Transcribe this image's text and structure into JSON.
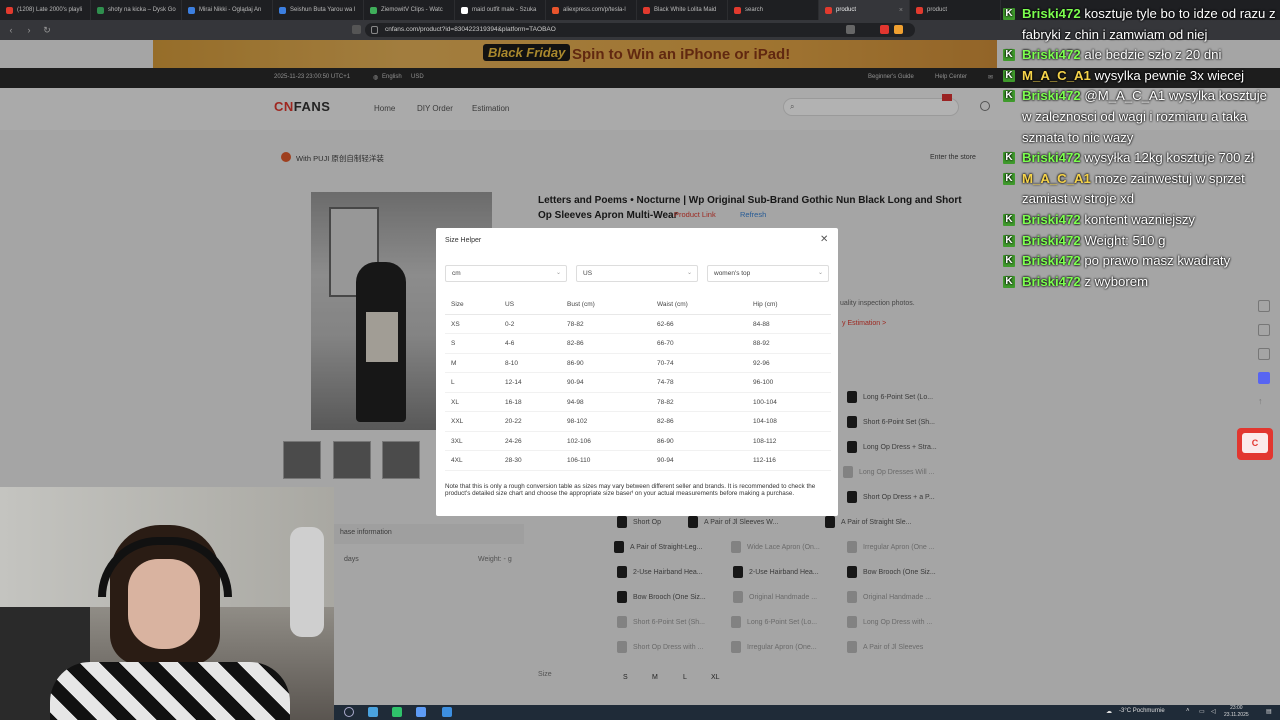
{
  "browser": {
    "tabs": [
      {
        "label": "(1208) Late 2000's playli",
        "color": "#e23a2e"
      },
      {
        "label": "shoty na kicka – Dysk Go",
        "color": "#2f8f4e"
      },
      {
        "label": "Mirai Nikki - Oglądaj An",
        "color": "#3c7fe0"
      },
      {
        "label": "Seishun Buta Yarou wa I",
        "color": "#3c7fe0"
      },
      {
        "label": "ZiemowitV Clips - Watc",
        "color": "#3fae5a"
      },
      {
        "label": "maid outfit male - Szuka",
        "color": "#ffffff"
      },
      {
        "label": "aliexpress.com/p/tesla-l",
        "color": "#e8542c"
      },
      {
        "label": "Black White Lolita Maid",
        "color": "#e23a2e"
      },
      {
        "label": "search",
        "color": "#e23a2e"
      },
      {
        "label": "product",
        "color": "#e23a2e",
        "active": true
      },
      {
        "label": "product",
        "color": "#e23a2e"
      }
    ],
    "url": "cnfans.com/product?id=830422319394&platform=TAOBAO"
  },
  "banner": {
    "badge": "Black Friday",
    "text": "Spin to Win an iPhone or iPad!"
  },
  "topbar": {
    "datetime": "2025-11-23 23:00:50 UTC+1",
    "lang": "English",
    "currency": "USD",
    "guide": "Beginner's Guide",
    "help": "Help Center"
  },
  "header": {
    "logo_a": "CN",
    "logo_b": "FANS",
    "nav": [
      "Home",
      "DIY Order",
      "Estimation"
    ]
  },
  "store": {
    "name": "With PUJI 原创自制轻洋装",
    "enter": "Enter the store"
  },
  "product": {
    "title": "Letters and Poems • Nocturne | Wp Original Sub-Brand Gothic Nun Black Long and Short Op Sleeves Apron Multi-Wear",
    "link": "Product Link",
    "refresh": "Refresh",
    "qc": "uality inspection photos.",
    "estimation": "y Estimation >"
  },
  "options": [
    {
      "label": "Long 6-Point Set (Lo...",
      "light": false
    },
    {
      "label": "Short 6-Point Set (Sh...",
      "light": false
    },
    {
      "label": "Long Op Dress + Stra...",
      "light": false
    },
    {
      "label": "Long Op Dresses Will ...",
      "light": true
    },
    {
      "label": "Short Op Dress + a P...",
      "light": false
    },
    {
      "label": "Short Op",
      "light": false
    },
    {
      "label": "A Pair of Jl Sleeves W...",
      "light": false
    },
    {
      "label": "A Pair of Straight Sle...",
      "light": false
    },
    {
      "label": "A Pair of Straight-Leg...",
      "light": false
    },
    {
      "label": "Wide Lace Apron (On...",
      "light": true
    },
    {
      "label": "Irregular Apron (One ...",
      "light": true
    },
    {
      "label": "2-Use Hairband Hea...",
      "light": false
    },
    {
      "label": "2-Use Hairband Hea...",
      "light": false
    },
    {
      "label": "Bow Brooch (One Siz...",
      "light": false
    },
    {
      "label": "Bow Brooch (One Siz...",
      "light": false
    },
    {
      "label": "Original Handmade ...",
      "light": true
    },
    {
      "label": "Original Handmade ...",
      "light": true
    },
    {
      "label": "Short 6-Point Set (Sh...",
      "light": true
    },
    {
      "label": "Long 6-Point Set (Lo...",
      "light": true
    },
    {
      "label": "Long Op Dress with ...",
      "light": true
    },
    {
      "label": "Short Op Dress with ...",
      "light": true
    },
    {
      "label": "Irregular Apron (One...",
      "light": true
    },
    {
      "label": "A Pair of Jl Sleeves",
      "light": true
    }
  ],
  "shipping": {
    "label": "hase information",
    "days": "days",
    "weight": "Weight: -  g"
  },
  "sizes": {
    "label": "Size",
    "buttons": [
      "S",
      "M",
      "L",
      "XL"
    ]
  },
  "modal": {
    "title": "Size Helper",
    "unit": "cm",
    "region": "US",
    "category": "women's top",
    "headers": [
      "Size",
      "US",
      "Bust (cm)",
      "Waist (cm)",
      "Hip (cm)"
    ],
    "rows": [
      [
        "XS",
        "0-2",
        "78-82",
        "62-66",
        "84-88"
      ],
      [
        "S",
        "4-6",
        "82-86",
        "66-70",
        "88-92"
      ],
      [
        "M",
        "8-10",
        "86-90",
        "70-74",
        "92-96"
      ],
      [
        "L",
        "12-14",
        "90-94",
        "74-78",
        "96-100"
      ],
      [
        "XL",
        "16-18",
        "94-98",
        "78-82",
        "100-104"
      ],
      [
        "XXL",
        "20-22",
        "98-102",
        "82-86",
        "104-108"
      ],
      [
        "3XL",
        "24-26",
        "102-106",
        "86-90",
        "108-112"
      ],
      [
        "4XL",
        "28-30",
        "106-110",
        "90-94",
        "112-116"
      ]
    ],
    "note": "Note that this is only a rough conversion table as sizes may vary between different seller and brands. It is recommended to check the product's detailed size chart and choose the appropriate size based on your actual measurements before making a purchase."
  },
  "chat": [
    {
      "user": "Briski472",
      "color": "#7cff4f",
      "text": "kosztuje tyle bo to idze od razu z fabryki z chin i zamwiam od niej"
    },
    {
      "user": "Briski472",
      "color": "#7cff4f",
      "text": "ale bedzie szło z 20 dni"
    },
    {
      "user": "M_A_C_A1",
      "color": "#f5d34a",
      "text": "wysylka pewnie 3x wiecej"
    },
    {
      "user": "Briski472",
      "color": "#7cff4f",
      "text": "@M_A_C_A1 wysylka kosztuje w zaleznosci od wagi i rozmiaru a taka szmata to nic wazy"
    },
    {
      "user": "Briski472",
      "color": "#7cff4f",
      "text": "wysyłka 12kg kosztuje 700 zł"
    },
    {
      "user": "M_A_C_A1",
      "color": "#f5d34a",
      "text": "moze zainwestuj w sprzet zamiast w stroje xd"
    },
    {
      "user": "Briski472",
      "color": "#7cff4f",
      "text": "kontent wazniejszy"
    },
    {
      "user": "Briski472",
      "color": "#7cff4f",
      "text": "Weight: 510 g"
    },
    {
      "user": "Briski472",
      "color": "#7cff4f",
      "text": "po prawo masz kwadraty"
    },
    {
      "user": "Briski472",
      "color": "#7cff4f",
      "text": "z wyborem"
    }
  ],
  "taskbar": {
    "weather": "-3°C Pochmurnie",
    "time": "23:00",
    "date": "23.11.2025"
  }
}
